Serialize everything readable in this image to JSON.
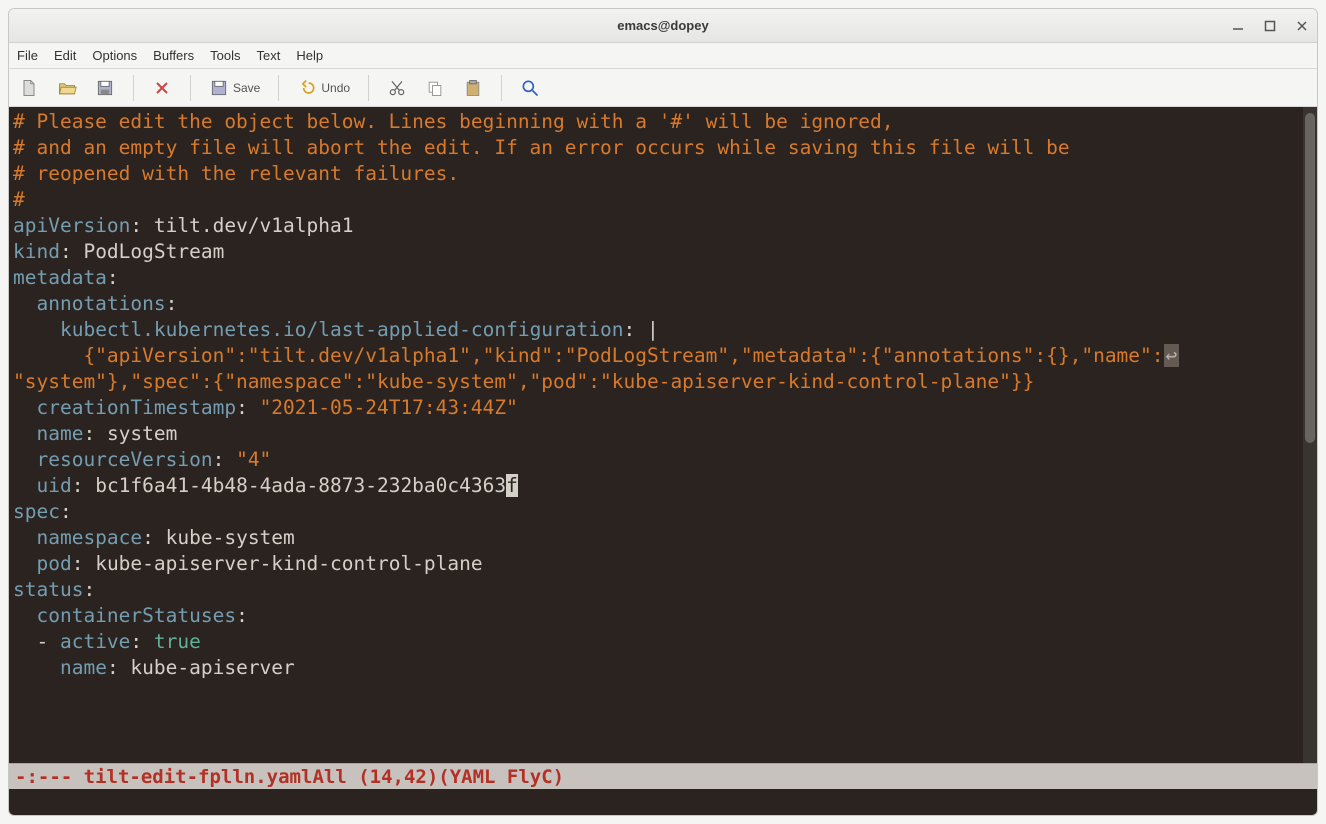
{
  "window": {
    "title": "emacs@dopey"
  },
  "menu": {
    "file": "File",
    "edit": "Edit",
    "options": "Options",
    "buffers": "Buffers",
    "tools": "Tools",
    "text": "Text",
    "help": "Help"
  },
  "toolbar": {
    "save": "Save",
    "undo": "Undo"
  },
  "code": {
    "comment1": "# Please edit the object below. Lines beginning with a '#' will be ignored,",
    "comment2": "# and an empty file will abort the edit. If an error occurs while saving this file will be",
    "comment3": "# reopened with the relevant failures.",
    "comment4": "#",
    "k_apiVersion": "apiVersion",
    "v_apiVersion": "tilt.dev/v1alpha1",
    "k_kind": "kind",
    "v_kind": "PodLogStream",
    "k_metadata": "metadata",
    "k_annotations": "annotations",
    "k_lastapplied": "kubectl.kubernetes.io/last-applied-configuration",
    "pipe": "|",
    "json_seg1": "      {\"apiVersion\":\"tilt.dev/v1alpha1\",\"kind\":\"PodLogStream\",\"metadata\":{\"annotations\":{},\"name\":",
    "json_seg2": "\"system\"},\"spec\":{\"namespace\":\"kube-system\",\"pod\":\"kube-apiserver-kind-control-plane\"}}",
    "k_creation": "creationTimestamp",
    "v_creation": "\"2021-05-24T17:43:44Z\"",
    "k_name": "name",
    "v_name": "system",
    "k_resver": "resourceVersion",
    "v_resver": "\"4\"",
    "k_uid": "uid",
    "v_uid_pre": "bc1f6a41-4b48-4ada-8873-232ba0c4363",
    "v_uid_cur": "f",
    "k_spec": "spec",
    "k_namespace": "namespace",
    "v_namespace": "kube-system",
    "k_pod": "pod",
    "v_pod": "kube-apiserver-kind-control-plane",
    "k_status": "status",
    "k_cstat": "containerStatuses",
    "k_active": "active",
    "v_true": "true",
    "k_name2": "name",
    "v_name2": "kube-apiserver"
  },
  "modeline": {
    "left": "-:--- ",
    "filename": "tilt-edit-fplln.yaml",
    "pos": "   All (14,42)    ",
    "mode": "(YAML FlyC)"
  }
}
